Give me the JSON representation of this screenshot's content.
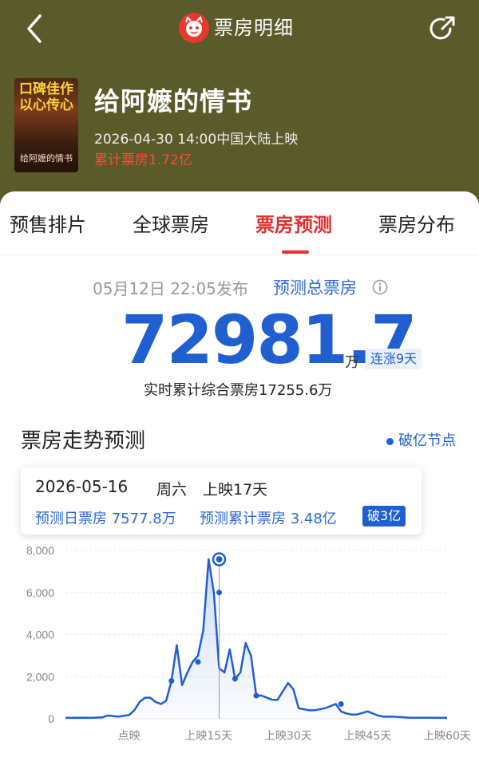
{
  "nav": {
    "title": "票房明细",
    "icons": [
      "back-icon",
      "maoyan-logo-icon",
      "share-icon"
    ]
  },
  "movie": {
    "poster_text_line1": "口碑佳作",
    "poster_text_line2": "以心传心",
    "poster_title": "给阿嬷的情书",
    "title": "给阿嬷的情书",
    "release": "2026-04-30 14:00中国大陆上映",
    "cumulative": "累计票房1.72亿"
  },
  "tabs": [
    {
      "label": "预售排片",
      "active": false
    },
    {
      "label": "全球票房",
      "active": false
    },
    {
      "label": "票房预测",
      "active": true
    },
    {
      "label": "票房分布",
      "active": false
    }
  ],
  "forecast": {
    "published": "05月12日 22:05发布",
    "label": "预测总票房",
    "value": "72981.7",
    "unit": "万",
    "badge": "连涨9天",
    "realtime": "实时累计综合票房17255.6万"
  },
  "trend": {
    "title": "票房走势预测",
    "legend": "破亿节点"
  },
  "tooltip": {
    "date": "2026-05-16",
    "weekday": "周六",
    "days": "上映17天",
    "daily": "预测日票房 7577.8万",
    "total": "预测累计票房 3.48亿",
    "badge": "破3亿"
  },
  "colors": {
    "accent": "#1f5fd0",
    "red": "#e03030",
    "header_bg": "#5a5a2a"
  },
  "chart_data": {
    "type": "area",
    "xlabel": "",
    "ylabel": "",
    "x_tick_labels": [
      {
        "x": 0,
        "label": "点映"
      },
      {
        "x": 15,
        "label": "上映15天"
      },
      {
        "x": 30,
        "label": "上映30天"
      },
      {
        "x": 45,
        "label": "上映45天"
      },
      {
        "x": 60,
        "label": "上映60天"
      }
    ],
    "y_ticks": [
      "0",
      "2,000",
      "4,000",
      "6,000",
      "8,000"
    ],
    "ylim": [
      0,
      8000
    ],
    "xlim": [
      -12,
      60
    ],
    "x": [
      -12,
      -9,
      -7,
      -5,
      -4,
      -2,
      0,
      1,
      2,
      3,
      4,
      5,
      6,
      7,
      8,
      9,
      10,
      11,
      12,
      13,
      14,
      15,
      16,
      17,
      18,
      19,
      20,
      21,
      22,
      23,
      24,
      25,
      26,
      27,
      28,
      30,
      31,
      32,
      33,
      34,
      35,
      37,
      39,
      40,
      41,
      42,
      43,
      45,
      47,
      48,
      50,
      53,
      56,
      60
    ],
    "series": [
      {
        "values": [
          40,
          50,
          40,
          70,
          150,
          100,
          180,
          400,
          800,
          1000,
          1000,
          800,
          700,
          850,
          1800,
          3500,
          1600,
          2200,
          2700,
          3000,
          4200,
          7578,
          6000,
          2400,
          2200,
          3300,
          1900,
          2200,
          3600,
          3000,
          1100,
          1100,
          1000,
          900,
          900,
          1700,
          1400,
          500,
          450,
          400,
          400,
          500,
          700,
          350,
          250,
          200,
          200,
          350,
          150,
          100,
          100,
          50,
          50,
          40
        ]
      }
    ],
    "marked_points": [
      {
        "x": 8,
        "y": 1800
      },
      {
        "x": 13,
        "y": 2700
      },
      {
        "x": 17,
        "y": 6000
      },
      {
        "x": 20,
        "y": 1900
      },
      {
        "x": 24,
        "y": 1100
      },
      {
        "x": 40,
        "y": 700
      }
    ],
    "highlight": {
      "x": 17,
      "y": 7578
    },
    "grid": true
  }
}
